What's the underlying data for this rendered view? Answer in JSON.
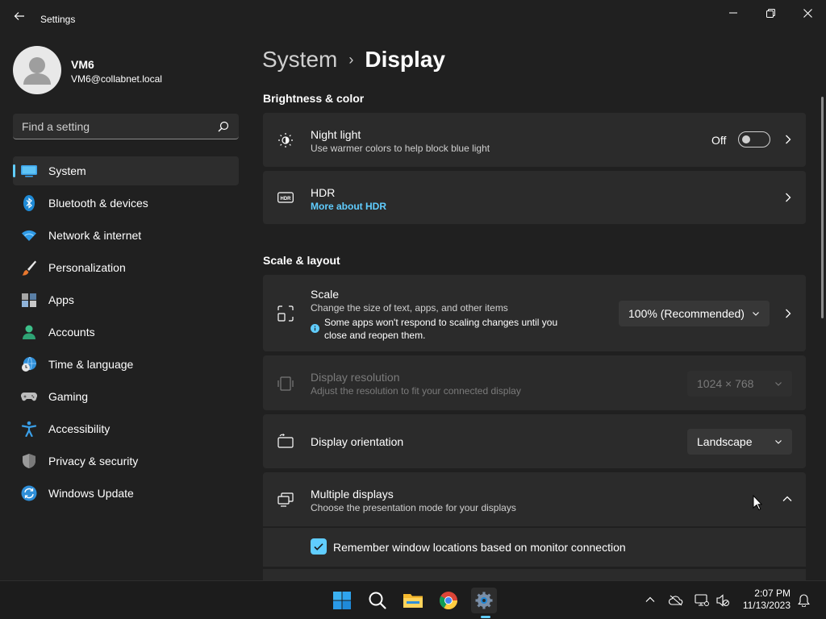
{
  "window": {
    "title": "Settings"
  },
  "profile": {
    "name": "VM6",
    "email": "VM6@collabnet.local"
  },
  "search": {
    "placeholder": "Find a setting",
    "value": ""
  },
  "sidebar": {
    "items": [
      {
        "label": "System",
        "icon": "system-icon",
        "selected": true
      },
      {
        "label": "Bluetooth & devices",
        "icon": "bluetooth-icon"
      },
      {
        "label": "Network & internet",
        "icon": "wifi-icon"
      },
      {
        "label": "Personalization",
        "icon": "brush-icon"
      },
      {
        "label": "Apps",
        "icon": "apps-icon"
      },
      {
        "label": "Accounts",
        "icon": "account-icon"
      },
      {
        "label": "Time & language",
        "icon": "globe-clock-icon"
      },
      {
        "label": "Gaming",
        "icon": "gamepad-icon"
      },
      {
        "label": "Accessibility",
        "icon": "accessibility-icon"
      },
      {
        "label": "Privacy & security",
        "icon": "shield-icon"
      },
      {
        "label": "Windows Update",
        "icon": "update-icon"
      }
    ]
  },
  "breadcrumb": {
    "parent": "System",
    "separator": "›",
    "current": "Display"
  },
  "sections": {
    "brightness": "Brightness & color",
    "scale": "Scale & layout"
  },
  "night_light": {
    "title": "Night light",
    "subtitle": "Use warmer colors to help block blue light",
    "state_label": "Off",
    "enabled": false
  },
  "hdr": {
    "title": "HDR",
    "link": "More about HDR"
  },
  "scale": {
    "title": "Scale",
    "subtitle": "Change the size of text, apps, and other items",
    "info_line1": "Some apps won't respond to scaling changes until you",
    "info_line2": "close and reopen them.",
    "value": "100% (Recommended)"
  },
  "resolution": {
    "title": "Display resolution",
    "subtitle": "Adjust the resolution to fit your connected display",
    "value": "1024 × 768",
    "disabled": true
  },
  "orientation": {
    "title": "Display orientation",
    "value": "Landscape"
  },
  "multiple_displays": {
    "title": "Multiple displays",
    "subtitle": "Choose the presentation mode for your displays",
    "expanded": true,
    "remember_label": "Remember window locations based on monitor connection",
    "remember_checked": true
  },
  "taskbar": {
    "apps": [
      "start-icon",
      "search-icon",
      "file-explorer-icon",
      "chrome-icon",
      "settings-icon"
    ],
    "active": "settings-icon",
    "time": "2:07 PM",
    "date": "11/13/2023"
  },
  "colors": {
    "background": "#202020",
    "card": "#2b2b2b",
    "accent": "#60cdff",
    "taskbar": "#1c1c1c"
  }
}
